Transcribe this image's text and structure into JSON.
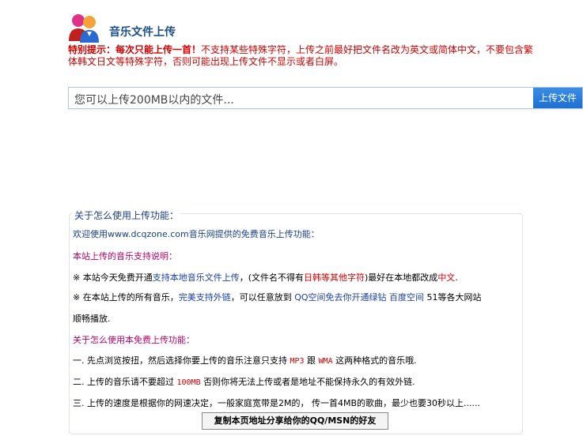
{
  "header": {
    "title": "音乐文件上传"
  },
  "notice": {
    "label": "特别提示：每次只能上传一首！",
    "text": "不支持某些特殊字符，上传之前最好把文件名改为英文或简体中文，不要包含繁体韩文日文等特殊字符，否则可能出现上传文件不显示或者白屏。"
  },
  "upload": {
    "placeholder": "您可以上传200MB以内的文件...",
    "button": "上传文件"
  },
  "help": {
    "title": "关于怎么使用上传功能：",
    "welcome": "欢迎使用www.dcqzone.com音乐网提供的免费音乐上传功能：",
    "support_heading": "本站上传的音乐支持说明：",
    "item1": {
      "a": "※ 本站今天免费开通",
      "b": "支持本地音乐文件上传",
      "c": "，(文件名不得有",
      "d": "日韩等其他字符",
      "e": ")最好在本地都改成",
      "f": "中文",
      "g": "."
    },
    "item2": {
      "a": "※ 在本站上传的所有音乐，",
      "b": "完美支持外链",
      "c": "，可以任意放到 ",
      "d": "QQ空间免去你开通绿钻",
      "e": " ",
      "f": "百度空间",
      "g": " 51等各大网站",
      "h": "顺畅播放."
    },
    "usage_heading": "关于怎么使用本免费上传功能：",
    "step1": {
      "a": "一. 先点浏览按扭，然后选择你要上传的音乐注意只支持 ",
      "b": "MP3",
      "c": " 跟 ",
      "d": "WMA",
      "e": " 这两种格式的音乐哦."
    },
    "step2": {
      "a": "二. 上传的音乐请不要超过 ",
      "b": "100MB",
      "c": " 否则你将无法上传或者是地址不能保持永久的有效外链."
    },
    "step3": "三. 上传的速度是根据你的网速决定，一般家庭宽带是2M的， 传一首4MB的歌曲，最少也要30秒以上......",
    "share_button": "复制本页地址分享给你的QQ/MSN的好友"
  }
}
